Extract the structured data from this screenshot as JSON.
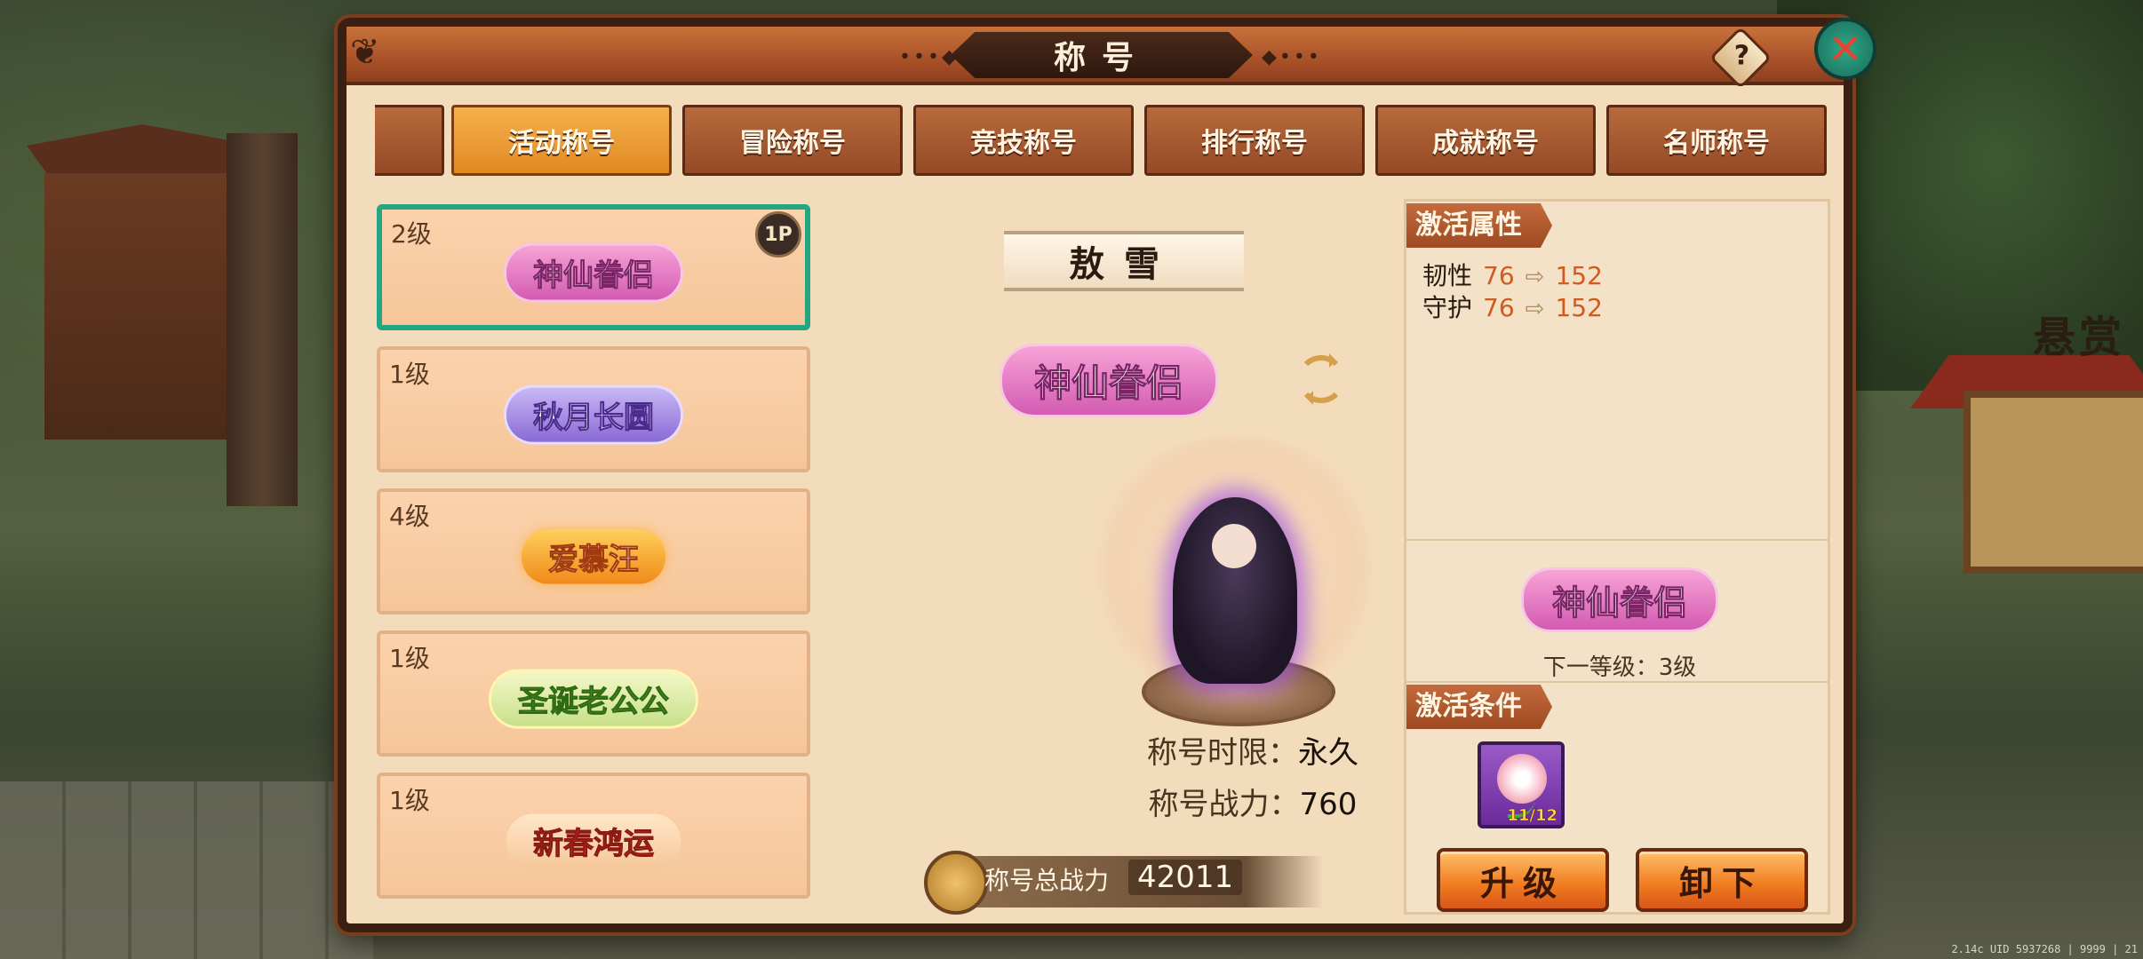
{
  "scene": {
    "sign": "悬赏",
    "uid": "2.14c UID 5937268 | 9999 | 21"
  },
  "window": {
    "title": "称号",
    "help": "?",
    "close": "✕"
  },
  "tabs": [
    {
      "label": "号",
      "active": false
    },
    {
      "label": "活动称号",
      "active": true
    },
    {
      "label": "冒险称号",
      "active": false
    },
    {
      "label": "竞技称号",
      "active": false
    },
    {
      "label": "排行称号",
      "active": false
    },
    {
      "label": "成就称号",
      "active": false
    },
    {
      "label": "名师称号",
      "active": false
    }
  ],
  "titles": [
    {
      "level": "2级",
      "name": "神仙眷侣",
      "style": "b-pink",
      "selected": true,
      "tag": "1P"
    },
    {
      "level": "1级",
      "name": "秋月长圆",
      "style": "b-purple",
      "selected": false
    },
    {
      "level": "4级",
      "name": "爱慕汪",
      "style": "b-orange",
      "selected": false
    },
    {
      "level": "1级",
      "name": "圣诞老公公",
      "style": "b-green",
      "selected": false
    },
    {
      "level": "1级",
      "name": "新春鸿运",
      "style": "b-red",
      "selected": false
    }
  ],
  "detail": {
    "character_name": "敖雪",
    "title_badge": "神仙眷侣",
    "duration_label": "称号时限：",
    "duration_value": "永久",
    "power_label": "称号战力：",
    "power_value": "760",
    "total_power_label": "称号总战力",
    "total_power_value": "42011"
  },
  "right": {
    "attr_header": "激活属性",
    "attributes": [
      {
        "name": "韧性",
        "from": "76",
        "to": "152"
      },
      {
        "name": "守护",
        "from": "76",
        "to": "152"
      }
    ],
    "next_badge": "神仙眷侣",
    "next_level": "下一等级：3级",
    "cond_header": "激活条件",
    "item_count": "11/12",
    "upgrade_label": "升级",
    "unequip_label": "卸下"
  },
  "colors": {
    "accent": "#f08a24",
    "selected_border": "#23a681",
    "attr_value": "#d25a1e"
  }
}
